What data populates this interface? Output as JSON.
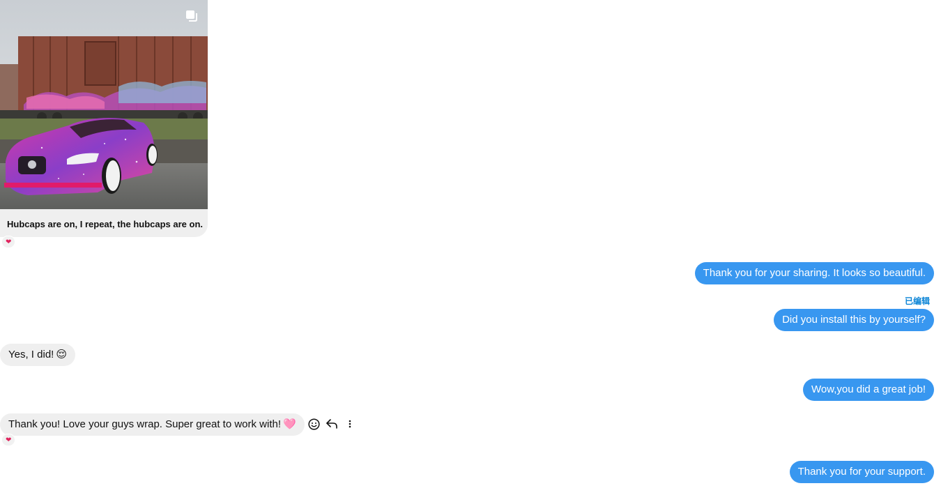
{
  "post": {
    "caption": "Hubcaps are on, I repeat, the hubcaps are on.",
    "reaction": "❤"
  },
  "messages": {
    "out_1": "Thank you for your sharing. It looks so beautiful.",
    "edited_label": "已编辑",
    "out_2": "Did you install this by yourself?",
    "in_1": "Yes, I did!",
    "in_1_emoji": "😌",
    "out_3": "Wow,you did a great job!",
    "in_2": "Thank you! Love your guys wrap. Super great to work with!",
    "in_2_emoji": "🩷",
    "in_2_reaction": "❤",
    "out_4": "Thank you for your support."
  },
  "icons": {
    "emoji": "smiley-icon",
    "reply": "reply-arrow-icon",
    "more": "more-vertical-icon",
    "carousel": "multiple-images-icon"
  },
  "colors": {
    "outgoing_bubble": "#3897f0",
    "incoming_bubble": "#efefef",
    "edited_label": "#0a84d6",
    "heart": "#e0245e"
  }
}
